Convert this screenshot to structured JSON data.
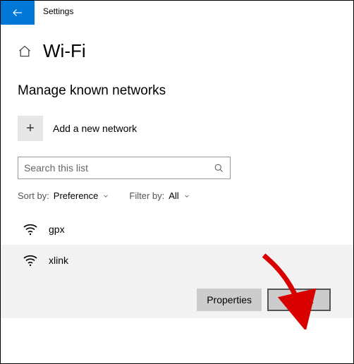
{
  "app": {
    "title": "Settings"
  },
  "page": {
    "title": "Wi-Fi"
  },
  "section": {
    "title": "Manage known networks"
  },
  "addNetwork": {
    "label": "Add a new network"
  },
  "search": {
    "placeholder": "Search this list"
  },
  "filters": {
    "sortLabel": "Sort by:",
    "sortValue": "Preference",
    "filterLabel": "Filter by:",
    "filterValue": "All"
  },
  "networks": {
    "n0": {
      "name": "gpx"
    },
    "n1": {
      "name": "xlink"
    }
  },
  "actions": {
    "properties": "Properties",
    "forget": "Forget"
  }
}
